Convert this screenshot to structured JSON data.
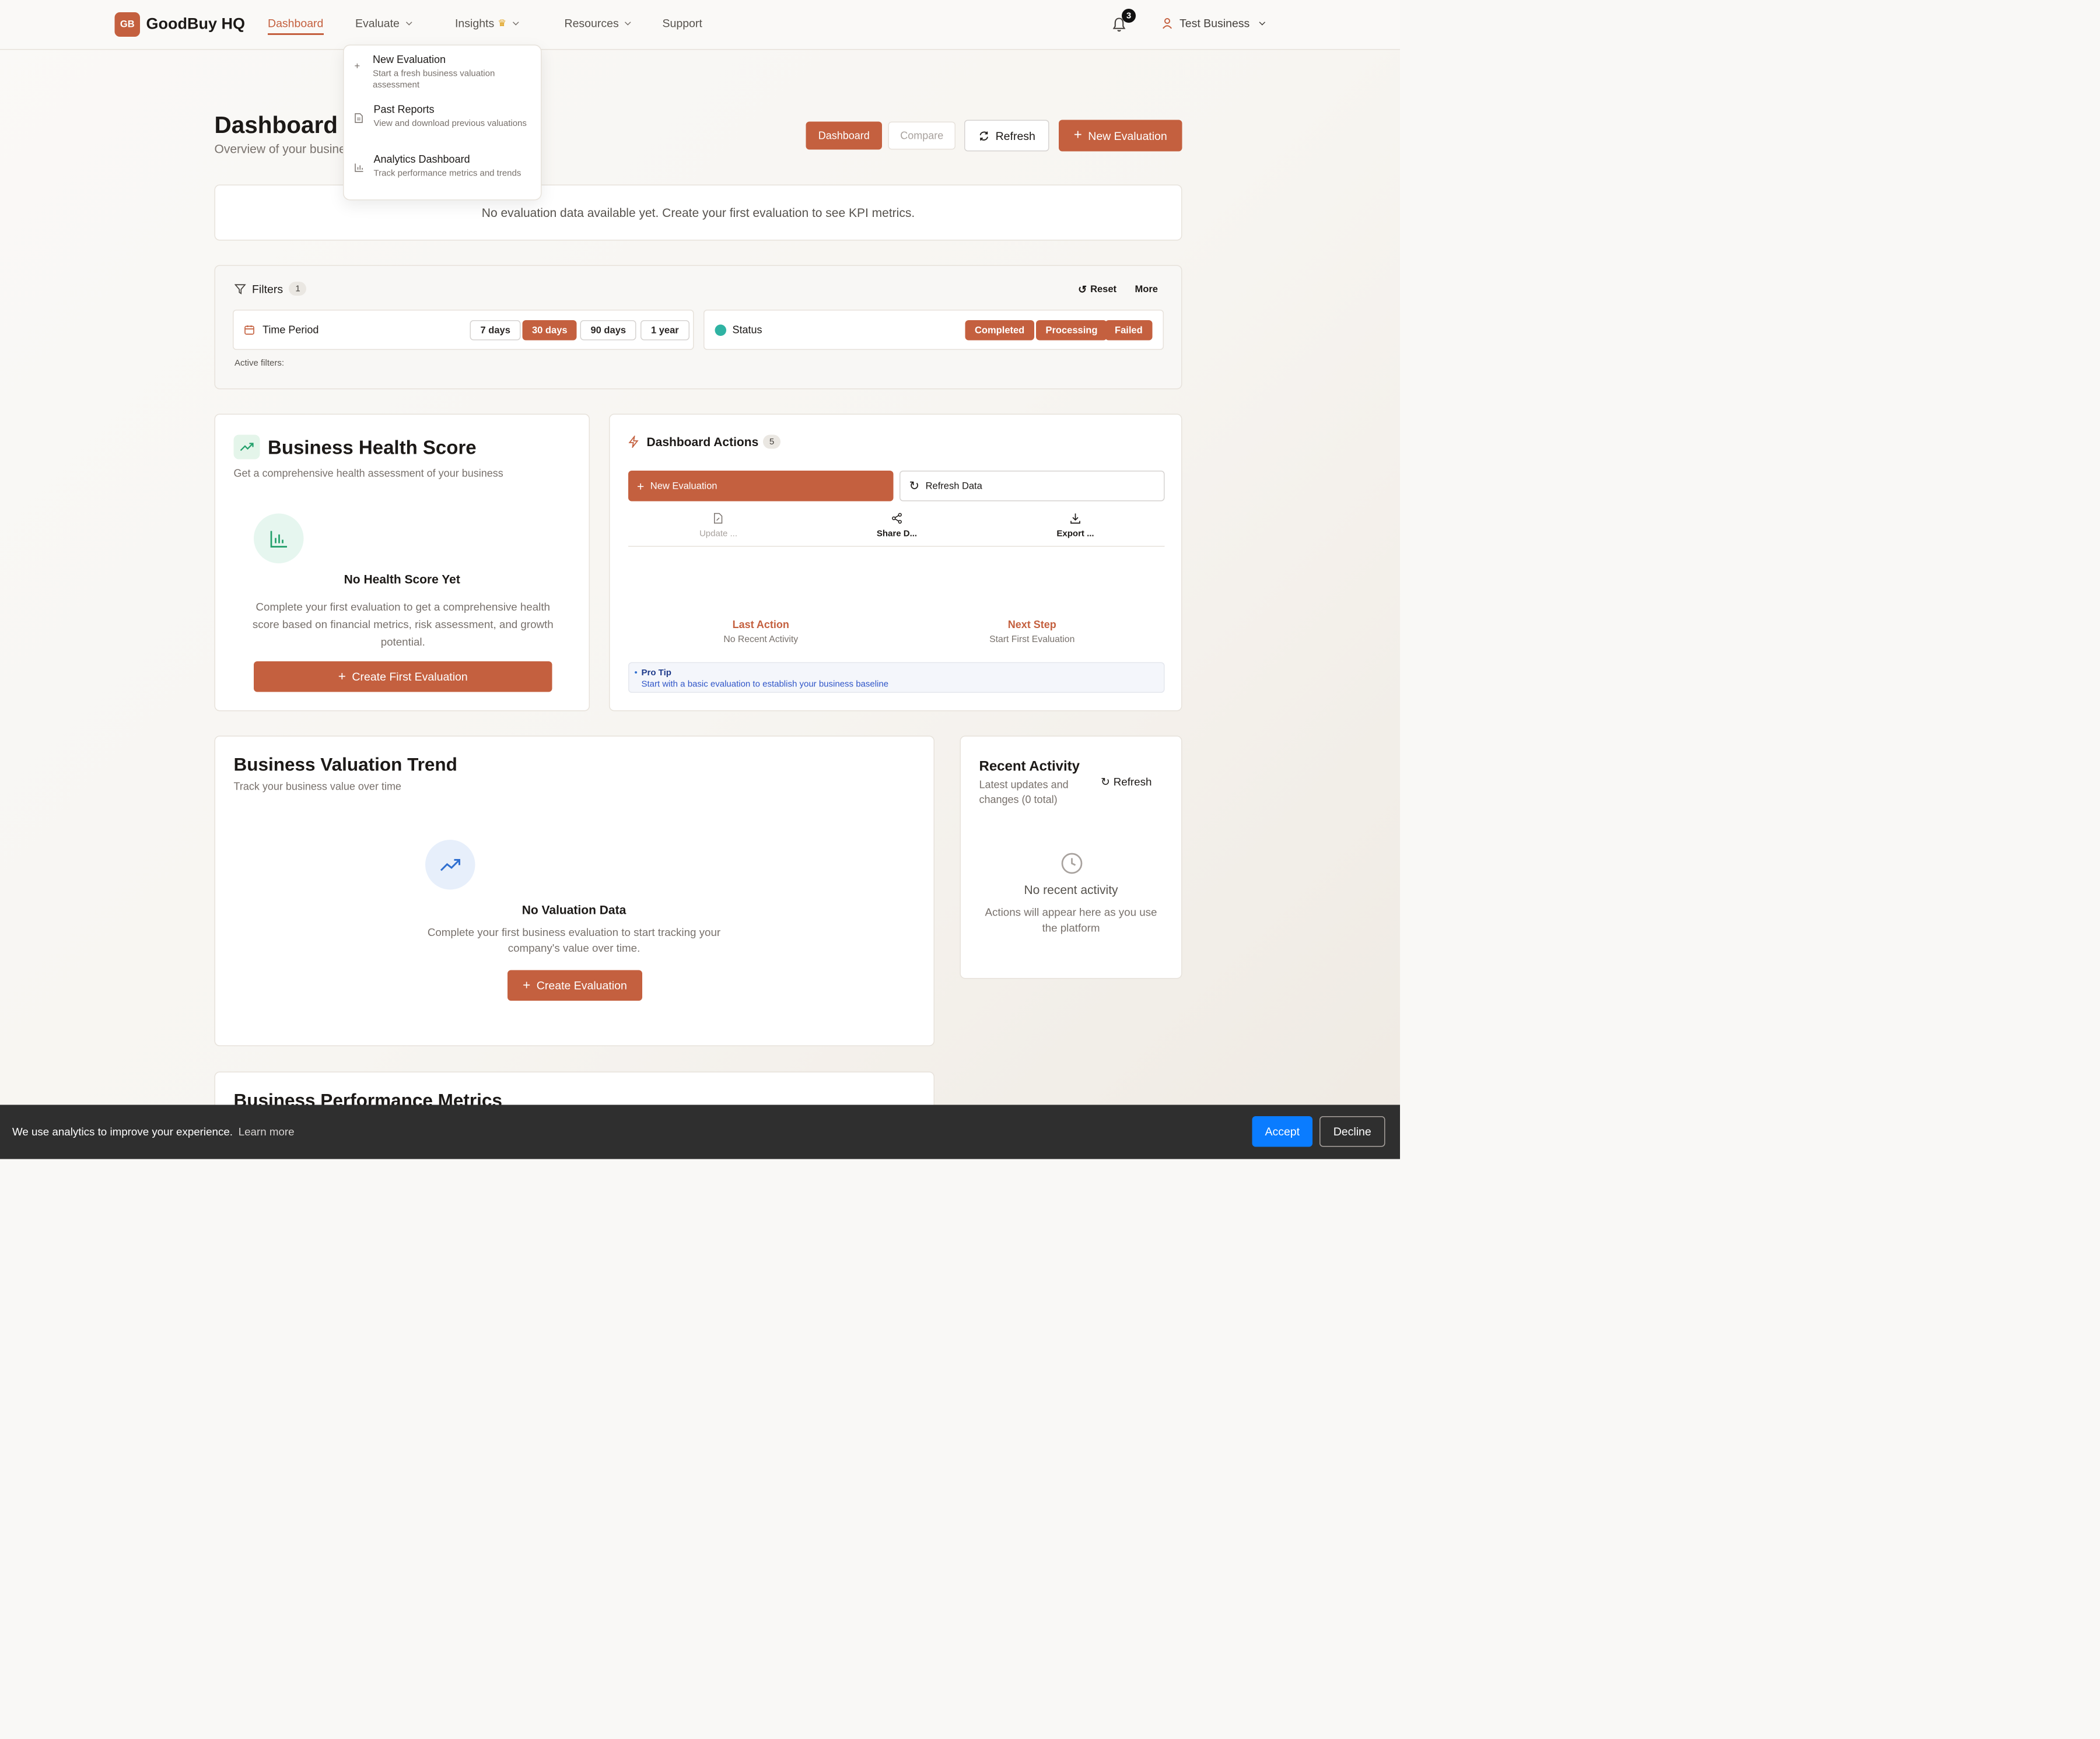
{
  "header": {
    "logo_initials": "GB",
    "brand": "GoodBuy HQ",
    "nav": [
      {
        "label": "Dashboard"
      },
      {
        "label": "Evaluate"
      },
      {
        "label": "Insights"
      },
      {
        "label": "Resources"
      },
      {
        "label": "Support"
      }
    ],
    "notifications_count": "3",
    "user_name": "Test Business"
  },
  "evaluate_menu": {
    "items": [
      {
        "title": "New Evaluation",
        "desc": "Start a fresh business valuation assessment"
      },
      {
        "title": "Past Reports",
        "desc": "View and download previous valuations"
      },
      {
        "title": "Analytics Dashboard",
        "desc": "Track performance metrics and trends"
      }
    ]
  },
  "page": {
    "title": "Dashboard",
    "subtitle": "Overview of your business valuations and activity",
    "toolbar": {
      "dashboard": "Dashboard",
      "compare": "Compare",
      "refresh": "Refresh",
      "new_evaluation": "New Evaluation"
    },
    "kpi_empty": "No evaluation data available yet. Create your first evaluation to see KPI metrics."
  },
  "filters": {
    "title": "Filters",
    "count": "1",
    "reset": "Reset",
    "more": "More",
    "time_period": {
      "label": "Time Period",
      "options": [
        "7 days",
        "30 days",
        "90 days",
        "1 year"
      ],
      "selected": "30 days"
    },
    "status": {
      "label": "Status",
      "options": [
        "Completed",
        "Processing",
        "Failed"
      ]
    },
    "active_filters_label": "Active filters:"
  },
  "health": {
    "title": "Business Health Score",
    "subtitle": "Get a comprehensive health assessment of your business",
    "empty_title": "No Health Score Yet",
    "empty_desc": "Complete your first evaluation to get a comprehensive health score based on financial metrics, risk assessment, and growth potential.",
    "cta": "Create First Evaluation"
  },
  "actions": {
    "title": "Dashboard Actions",
    "count": "5",
    "new_evaluation": "New Evaluation",
    "refresh_data": "Refresh Data",
    "quick": [
      {
        "label": "Update ...",
        "icon": "file-edit-icon"
      },
      {
        "label": "Share D...",
        "icon": "share-icon"
      },
      {
        "label": "Export ...",
        "icon": "download-icon"
      }
    ],
    "last_action_label": "Last Action",
    "last_action_value": "No Recent Activity",
    "next_step_label": "Next Step",
    "next_step_value": "Start First Evaluation",
    "tip_title": "Pro Tip",
    "tip_text": "Start with a basic evaluation to establish your business baseline"
  },
  "trend": {
    "title": "Business Valuation Trend",
    "subtitle": "Track your business value over time",
    "empty_title": "No Valuation Data",
    "empty_desc": "Complete your first business evaluation to start tracking your company's value over time.",
    "cta": "Create Evaluation"
  },
  "activity": {
    "title": "Recent Activity",
    "subtitle": "Latest updates and changes (0 total)",
    "refresh": "Refresh",
    "empty_title": "No recent activity",
    "empty_desc": "Actions will appear here as you use the platform"
  },
  "metrics": {
    "title": "Business Performance Metrics"
  },
  "cookie": {
    "message": "We use analytics to improve your experience.",
    "learn_more": "Learn more",
    "accept": "Accept",
    "decline": "Decline"
  },
  "colors": {
    "accent": "#c4603f",
    "accept_blue": "#0a7cff",
    "success_green": "#22a06b",
    "info_blue": "#2f6fd0",
    "status_teal": "#2fb3a3"
  }
}
